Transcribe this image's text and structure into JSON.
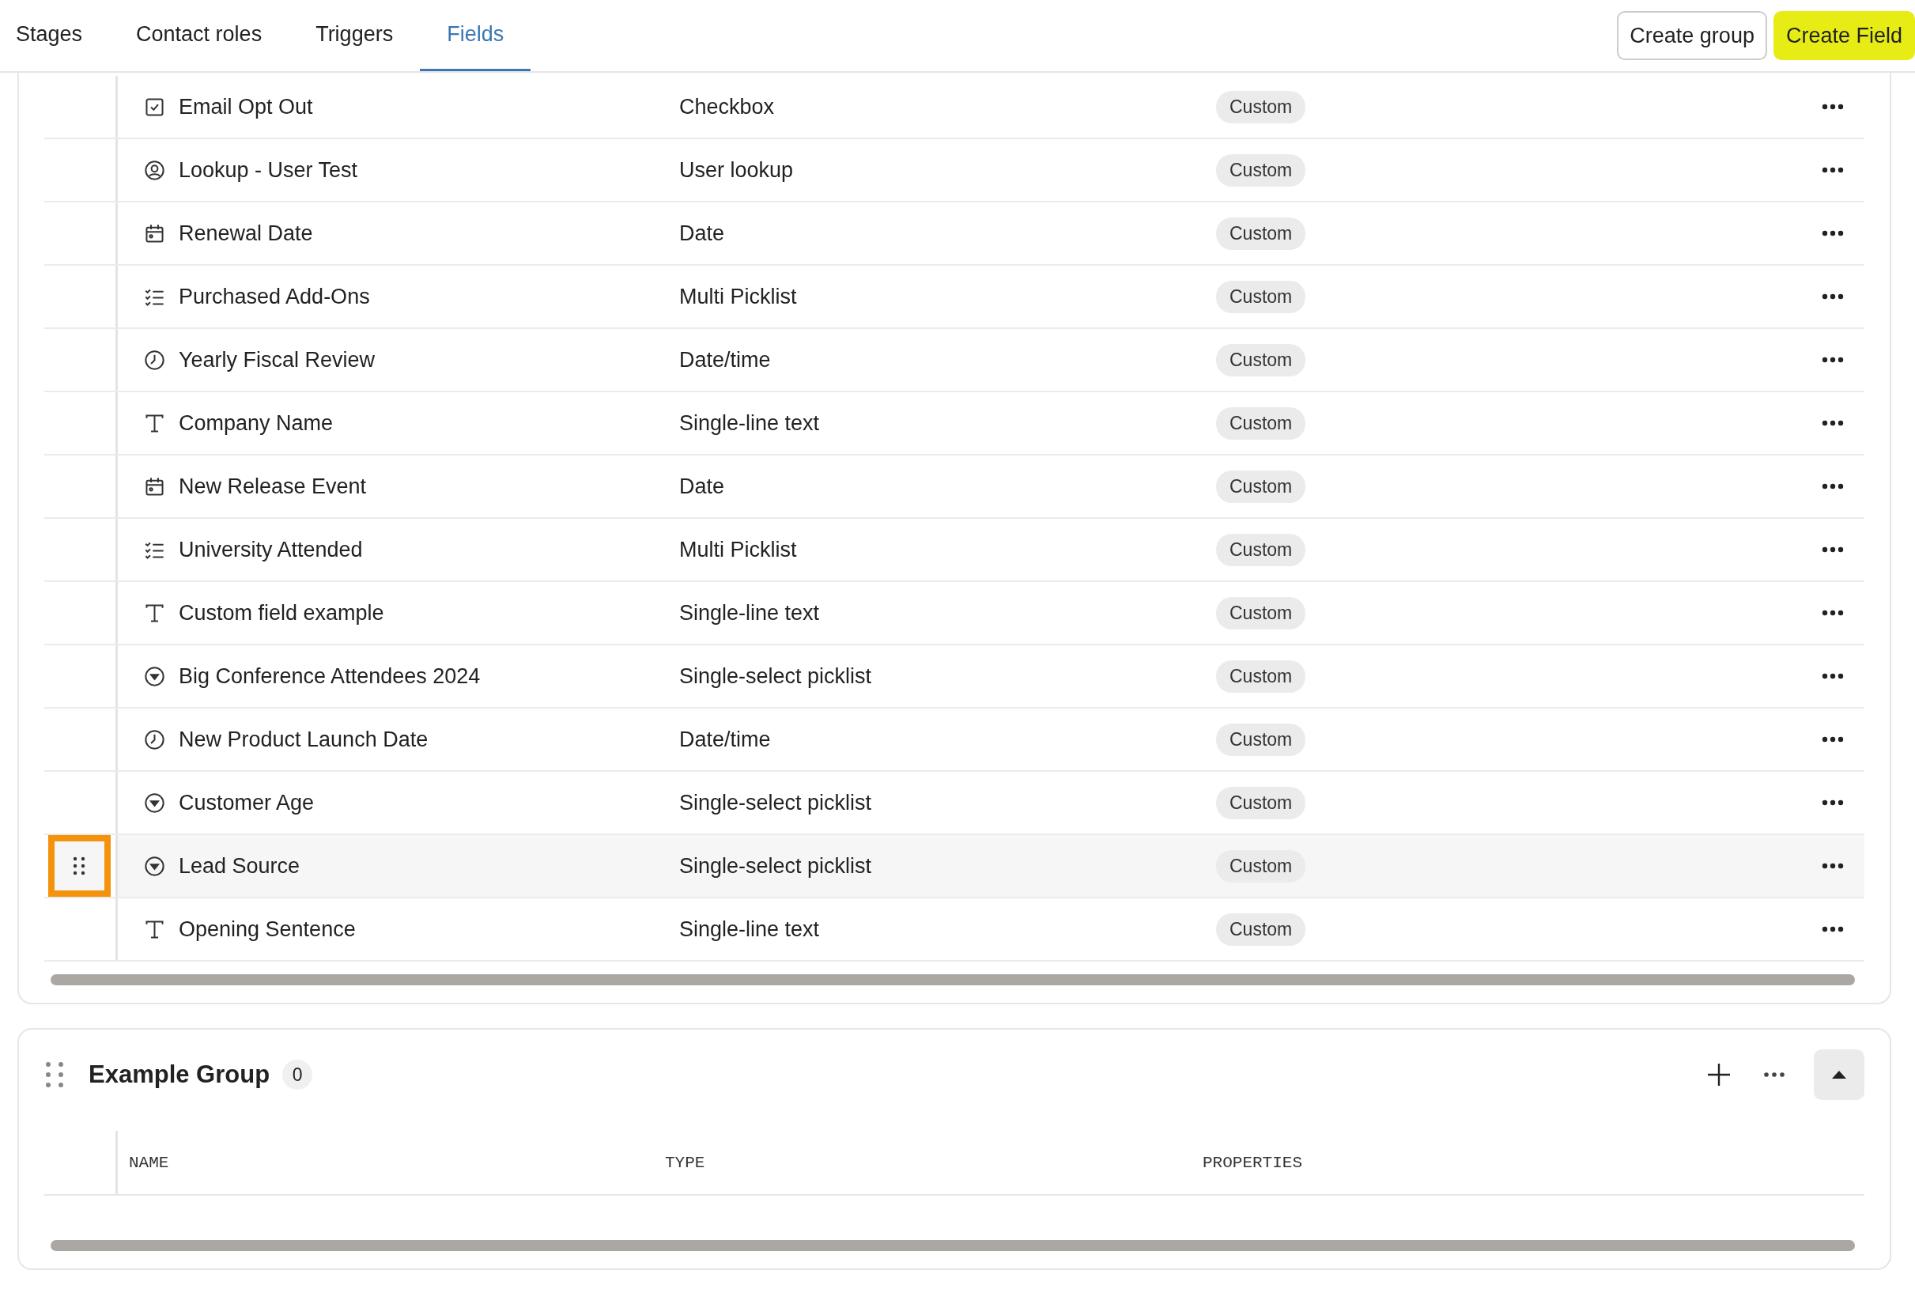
{
  "tabs": [
    {
      "label": "Stages",
      "selected": false
    },
    {
      "label": "Contact roles",
      "selected": false
    },
    {
      "label": "Triggers",
      "selected": false
    },
    {
      "label": "Fields",
      "selected": true
    }
  ],
  "header_buttons": [
    {
      "label": "Create group",
      "kind": "secondary"
    },
    {
      "label": "Create Field",
      "kind": "primary"
    }
  ],
  "fields_table": {
    "rows": [
      {
        "kind": "checkbox",
        "name": "Email Opt Out",
        "type": "Checkbox",
        "property": "Custom",
        "selected": false
      },
      {
        "kind": "user",
        "name": "Lookup - User Test",
        "type": "User lookup",
        "property": "Custom",
        "selected": false
      },
      {
        "kind": "calendar",
        "name": "Renewal Date",
        "type": "Date",
        "property": "Custom",
        "selected": false
      },
      {
        "kind": "checklist",
        "name": "Purchased Add-Ons",
        "type": "Multi Picklist",
        "property": "Custom",
        "selected": false
      },
      {
        "kind": "clock",
        "name": "Yearly Fiscal Review",
        "type": "Date/time",
        "property": "Custom",
        "selected": false
      },
      {
        "kind": "text",
        "name": "Company Name",
        "type": "Single-line text",
        "property": "Custom",
        "selected": false
      },
      {
        "kind": "calendar",
        "name": "New Release Event",
        "type": "Date",
        "property": "Custom",
        "selected": false
      },
      {
        "kind": "checklist",
        "name": "University Attended",
        "type": "Multi Picklist",
        "property": "Custom",
        "selected": false
      },
      {
        "kind": "text",
        "name": "Custom field example",
        "type": "Single-line text",
        "property": "Custom",
        "selected": false
      },
      {
        "kind": "select",
        "name": "Big Conference Attendees 2024",
        "type": "Single-select picklist",
        "property": "Custom",
        "selected": false
      },
      {
        "kind": "clock",
        "name": "New Product Launch Date",
        "type": "Date/time",
        "property": "Custom",
        "selected": false
      },
      {
        "kind": "select",
        "name": "Customer Age",
        "type": "Single-select picklist",
        "property": "Custom",
        "selected": false
      },
      {
        "kind": "select",
        "name": "Lead Source",
        "type": "Single-select picklist",
        "property": "Custom",
        "selected": true
      },
      {
        "kind": "text",
        "name": "Opening Sentence",
        "type": "Single-line text",
        "property": "Custom",
        "selected": false
      }
    ]
  },
  "group": {
    "title": "Example Group",
    "count": "0",
    "expanded": true,
    "columns": [
      "NAME",
      "TYPE",
      "PROPERTIES"
    ]
  }
}
